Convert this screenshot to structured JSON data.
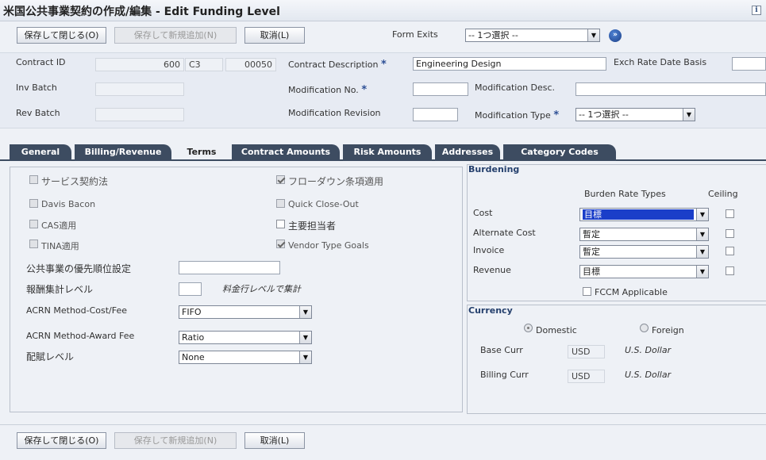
{
  "window": {
    "title": "米国公共事業契約の作成/編集 - Edit Funding Level"
  },
  "toolbar": {
    "save_close": "保存して閉じる(O)",
    "save_new": "保存して新規追加(N)",
    "cancel": "取消(L)",
    "form_exits_label": "Form Exits",
    "form_exits_value": "-- 1つ選択 --"
  },
  "header": {
    "contract_id_label": "Contract ID",
    "contract_id_1": "600",
    "contract_id_2": "C3",
    "contract_id_3": "00050",
    "contract_desc_label": "Contract Description",
    "contract_desc_value": "Engineering Design",
    "exch_rate_label": "Exch Rate Date Basis",
    "exch_rate_value": "",
    "inv_batch_label": "Inv Batch",
    "inv_batch_value": "",
    "mod_no_label": "Modification No.",
    "mod_no_value": "",
    "mod_desc_label": "Modification Desc.",
    "mod_desc_value": "",
    "rev_batch_label": "Rev Batch",
    "rev_batch_value": "",
    "mod_rev_label": "Modification Revision",
    "mod_rev_value": "",
    "mod_type_label": "Modification Type",
    "mod_type_value": "-- 1つ選択 --",
    "required_mark": "*"
  },
  "tabs": [
    {
      "label": "General"
    },
    {
      "label": "Billing/Revenue"
    },
    {
      "label": "Terms"
    },
    {
      "label": "Contract Amounts"
    },
    {
      "label": "Risk Amounts"
    },
    {
      "label": "Addresses"
    },
    {
      "label": "Category Codes"
    }
  ],
  "terms": {
    "service_contract": "サービス契約法",
    "flowdown": "フローダウン条項適用",
    "davis_bacon": "Davis Bacon",
    "quick_close": "Quick Close-Out",
    "cas": "CAS適用",
    "main_person": "主要担当者",
    "tina": "TINA適用",
    "vendor_goals": "Vendor Type Goals",
    "priority_label": "公共事業の優先順位設定",
    "priority_value": "",
    "fee_level_label": "報酬集計レベル",
    "fee_level_value": "",
    "fee_level_note": "料金行レベルで集計",
    "acrn_cost_label": "ACRN Method-Cost/Fee",
    "acrn_cost_value": "FIFO",
    "acrn_award_label": "ACRN Method-Award Fee",
    "acrn_award_value": "Ratio",
    "alloc_level_label": "配賦レベル",
    "alloc_level_value": "None"
  },
  "burdening": {
    "title": "Burdening",
    "col_types": "Burden Rate Types",
    "col_ceiling": "Ceiling",
    "cost_label": "Cost",
    "cost_value": "目標",
    "alt_cost_label": "Alternate Cost",
    "alt_cost_value": "暫定",
    "invoice_label": "Invoice",
    "invoice_value": "暫定",
    "revenue_label": "Revenue",
    "revenue_value": "目標",
    "fccm_label": "FCCM Applicable"
  },
  "currency": {
    "title": "Currency",
    "domestic": "Domestic",
    "foreign": "Foreign",
    "base_label": "Base Curr",
    "base_code": "USD",
    "base_name": "U.S. Dollar",
    "billing_label": "Billing Curr",
    "billing_code": "USD",
    "billing_name": "U.S. Dollar"
  }
}
